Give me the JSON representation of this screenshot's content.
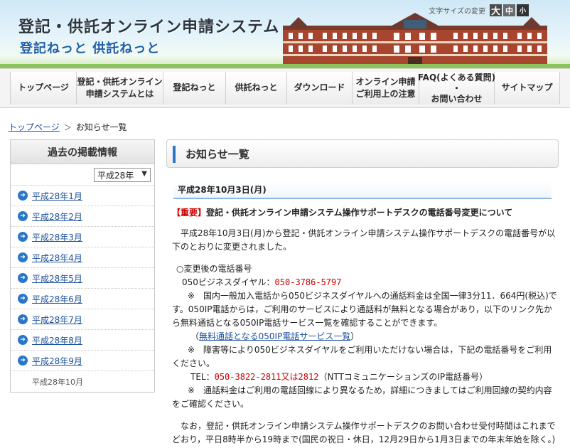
{
  "header": {
    "title": "登記・供託オンライン申請システム",
    "subtitle": "登記ねっと 供託ねっと",
    "font_size_label": "文字サイズの変更",
    "font_size_buttons": [
      "大",
      "中",
      "小"
    ]
  },
  "nav": [
    {
      "label": "トップページ"
    },
    {
      "label": "登記・供託オンライン\n申請システムとは"
    },
    {
      "label": "登記ねっと"
    },
    {
      "label": "供託ねっと"
    },
    {
      "label": "ダウンロード"
    },
    {
      "label": "オンライン申請\nご利用上の注意"
    },
    {
      "label": "FAQ(よくある質問)\n・\nお問い合わせ"
    },
    {
      "label": "サイトマップ"
    }
  ],
  "breadcrumb": {
    "home": "トップページ",
    "separator": "＞",
    "current": "お知らせ一覧"
  },
  "sidebar": {
    "heading": "過去の掲載情報",
    "year_select": "平成28年",
    "months": [
      "平成28年1月",
      "平成28年2月",
      "平成28年3月",
      "平成28年4月",
      "平成28年5月",
      "平成28年6月",
      "平成28年7月",
      "平成28年8月",
      "平成28年9月"
    ],
    "current_month": "平成28年10月"
  },
  "main": {
    "page_title": "お知らせ一覧",
    "date": "平成28年10月3日(月)",
    "notice_tag": "【重要】",
    "notice_title": "登記・供託オンライン申請システム操作サポートデスクの電話番号変更について",
    "intro": "　平成28年10月3日(月)から登記・供託オンライン申請システム操作サポートデスクの電話番号が以下のとおりに変更されました。",
    "new_number_heading": "○変更後の電話番号",
    "dial_label": "050ビジネスダイヤル：",
    "dial_number": "050-3786-5797",
    "note1": "※　国内一般加入電話から050ビジネスダイヤルへの通話料金は全国一律3分11．664円(税込)です。050IP電話からは，ご利用のサービスにより通話料が無料となる場合があり，以下のリンク先から無料通話となる050IP電話サービス一覧を確認することができます。",
    "link_open": "（",
    "link_text": "無料通話となる050IP電話サービス一覧",
    "link_close": "）",
    "note2": "※　障害等により050ビジネスダイヤルをご利用いただけない場合は，下記の電話番号をご利用ください。",
    "tel_label": "TEL：",
    "tel_number": "050-3822-2811又は2812",
    "tel_note": "（NTTコミュニケーションズのIP電話番号）",
    "note3": "※　通話料金はご利用の電話回線により異なるため，詳細につきましてはご利用回線の契約内容をご確認ください。",
    "closing": "　なお，登記・供託オンライン申請システム操作サポートデスクのお問い合わせ受付時間はこれまでどおり，平日8時半から19時まで(国民の祝日・休日，12月29日から1月3日までの年末年始を除く。)です。"
  },
  "colors": {
    "link": "#1a4f9c",
    "important": "#cc0000",
    "accent": "#2a77c9"
  }
}
